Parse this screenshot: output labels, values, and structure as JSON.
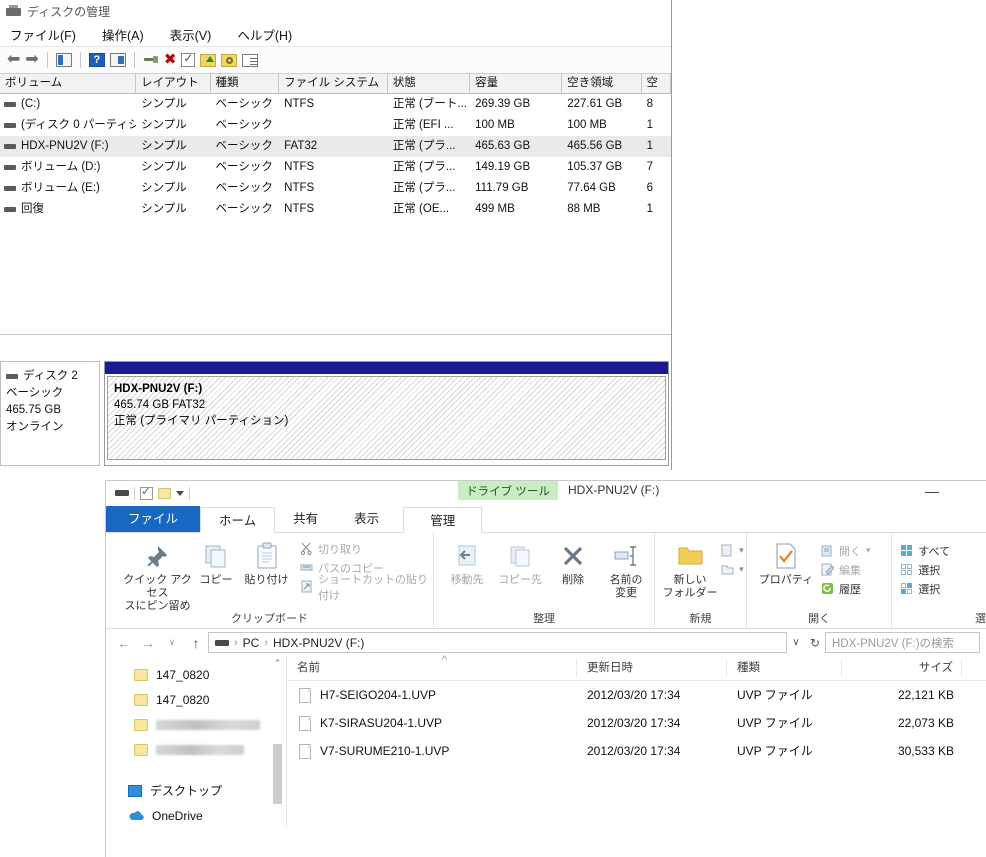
{
  "disk_management": {
    "title": "ディスクの管理",
    "menu": [
      "ファイル(F)",
      "操作(A)",
      "表示(V)",
      "ヘルプ(H)"
    ],
    "toolbar_icons": [
      "back-arrow-icon",
      "forward-arrow-icon",
      "show-hide-console-tree-icon",
      "help-icon",
      "show-hide-action-pane-icon",
      "properties-wrench-icon",
      "delete-x-icon",
      "rescan-disks-icon",
      "import-foreign-disk-icon",
      "inspect-icon",
      "list-icon"
    ],
    "columns": [
      "ボリューム",
      "レイアウト",
      "種類",
      "ファイル システム",
      "状態",
      "容量",
      "空き領域",
      "空"
    ],
    "rows": [
      {
        "volume": "(C:)",
        "layout": "シンプル",
        "type": "ベーシック",
        "fs": "NTFS",
        "status": "正常 (ブート...",
        "capacity": "269.39 GB",
        "free": "227.61 GB",
        "pct": "8",
        "selected": false
      },
      {
        "volume": "(ディスク 0 パーティシ...",
        "layout": "シンプル",
        "type": "ベーシック",
        "fs": "",
        "status": "正常 (EFI ...",
        "capacity": "100 MB",
        "free": "100 MB",
        "pct": "1",
        "selected": false
      },
      {
        "volume": "HDX-PNU2V (F:)",
        "layout": "シンプル",
        "type": "ベーシック",
        "fs": "FAT32",
        "status": "正常 (プラ...",
        "capacity": "465.63 GB",
        "free": "465.56 GB",
        "pct": "1",
        "selected": true
      },
      {
        "volume": "ボリューム (D:)",
        "layout": "シンプル",
        "type": "ベーシック",
        "fs": "NTFS",
        "status": "正常 (プラ...",
        "capacity": "149.19 GB",
        "free": "105.37 GB",
        "pct": "7",
        "selected": false
      },
      {
        "volume": "ボリューム (E:)",
        "layout": "シンプル",
        "type": "ベーシック",
        "fs": "NTFS",
        "status": "正常 (プラ...",
        "capacity": "111.79 GB",
        "free": "77.64 GB",
        "pct": "6",
        "selected": false
      },
      {
        "volume": "回復",
        "layout": "シンプル",
        "type": "ベーシック",
        "fs": "NTFS",
        "status": "正常 (OE...",
        "capacity": "499 MB",
        "free": "88 MB",
        "pct": "1",
        "selected": false
      }
    ],
    "disk_panel": {
      "name": "ディスク 2",
      "type": "ベーシック",
      "size": "465.75 GB",
      "state": "オンライン"
    },
    "partition": {
      "label": "HDX-PNU2V  (F:)",
      "size_fs": "465.74 GB FAT32",
      "status": "正常 (プライマリ パーティション)",
      "header_color": "#1b1b8f"
    }
  },
  "explorer": {
    "title": "HDX-PNU2V (F:)",
    "context_tab_label": "ドライブ ツール",
    "context_tab_color": "#c9ecc2",
    "minimize_glyph": "—",
    "quick_access_icons": [
      "drive-icon",
      "properties-icon",
      "new-folder-icon",
      "customize-caret-icon"
    ],
    "tabs": [
      {
        "label": "ファイル",
        "kind": "file"
      },
      {
        "label": "ホーム",
        "kind": "active"
      },
      {
        "label": "共有",
        "kind": "normal"
      },
      {
        "label": "表示",
        "kind": "normal"
      },
      {
        "label": "管理",
        "kind": "context"
      }
    ],
    "ribbon": {
      "groups": [
        {
          "title": "クリップボード",
          "large": [
            {
              "label1": "クイック アクセス",
              "label2": "スにピン留め",
              "icon": "pin-icon",
              "dim": false
            },
            {
              "label1": "コピー",
              "label2": "",
              "icon": "copy-icon",
              "dim": false
            },
            {
              "label1": "貼り付け",
              "label2": "",
              "icon": "paste-icon",
              "dim": false
            }
          ],
          "small": [
            {
              "label": "切り取り",
              "icon": "scissors-icon",
              "dim": true
            },
            {
              "label": "パスのコピー",
              "icon": "copy-path-icon",
              "dim": true
            },
            {
              "label": "ショートカットの貼り付け",
              "icon": "paste-shortcut-icon",
              "dim": true
            }
          ]
        },
        {
          "title": "整理",
          "large": [
            {
              "label1": "移動先",
              "label2": "",
              "icon": "move-to-icon",
              "dim": true
            },
            {
              "label1": "コピー先",
              "label2": "",
              "icon": "copy-to-icon",
              "dim": true
            },
            {
              "label1": "削除",
              "label2": "",
              "icon": "delete-icon",
              "dim": false
            },
            {
              "label1": "名前の",
              "label2": "変更",
              "icon": "rename-icon",
              "dim": false
            }
          ],
          "small": []
        },
        {
          "title": "新規",
          "large": [
            {
              "label1": "新しい",
              "label2": "フォルダー",
              "icon": "new-folder-icon",
              "dim": false
            }
          ],
          "small": [
            {
              "label": "",
              "icon": "new-item-icon",
              "dim": true
            },
            {
              "label": "",
              "icon": "easy-access-icon",
              "dim": true
            }
          ]
        },
        {
          "title": "開く",
          "large": [
            {
              "label1": "プロパティ",
              "label2": "",
              "icon": "properties-icon",
              "dim": false
            }
          ],
          "small": [
            {
              "label": "開く",
              "icon": "open-icon",
              "dim": true
            },
            {
              "label": "編集",
              "icon": "edit-icon",
              "dim": true
            },
            {
              "label": "履歴",
              "icon": "history-icon",
              "dim": false
            }
          ]
        },
        {
          "title": "選",
          "large": [],
          "small": [
            {
              "label": "すべて",
              "icon": "select-all-icon",
              "dim": false
            },
            {
              "label": "選択",
              "icon": "select-none-icon",
              "dim": false
            },
            {
              "label": "選択",
              "icon": "invert-selection-icon",
              "dim": false
            }
          ]
        }
      ]
    },
    "address": {
      "back_glyph": "←",
      "forward_glyph": "→",
      "recent_glyph": "∨",
      "up_glyph": "↑",
      "crumbs": [
        "PC",
        "HDX-PNU2V (F:)"
      ],
      "drive_icon": "drive-icon",
      "dropdown_glyph": "∨",
      "refresh_glyph": "↻",
      "search_placeholder": "HDX-PNU2V (F:)の検索"
    },
    "nav_pane": {
      "items": [
        {
          "label": "147_0820",
          "icon": "folder-icon",
          "blurred": false
        },
        {
          "label": "147_0820",
          "icon": "folder-icon",
          "blurred": false
        },
        {
          "label": "",
          "icon": "folder-icon",
          "blurred": true
        },
        {
          "label": "",
          "icon": "folder-icon",
          "blurred": true
        },
        {
          "label": "デスクトップ",
          "icon": "desktop-icon",
          "blurred": false
        },
        {
          "label": "OneDrive",
          "icon": "onedrive-icon",
          "blurred": false
        }
      ]
    },
    "file_list": {
      "columns": [
        "名前",
        "更新日時",
        "種類",
        "サイズ"
      ],
      "sort_column": "名前",
      "sort_glyph": "^",
      "rows": [
        {
          "name": "H7-SEIGO204-1.UVP",
          "date": "2012/03/20 17:34",
          "type": "UVP ファイル",
          "size": "22,121 KB"
        },
        {
          "name": "K7-SIRASU204-1.UVP",
          "date": "2012/03/20 17:34",
          "type": "UVP ファイル",
          "size": "22,073 KB"
        },
        {
          "name": "V7-SURUME210-1.UVP",
          "date": "2012/03/20 17:34",
          "type": "UVP ファイル",
          "size": "30,533 KB"
        }
      ]
    }
  }
}
